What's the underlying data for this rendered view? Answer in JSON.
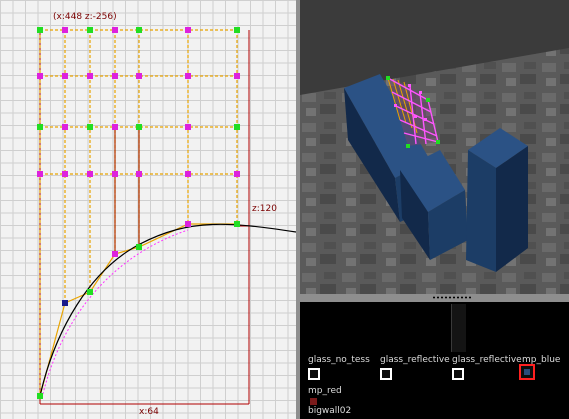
{
  "grid_view": {
    "top_coord_label": "(x:448  z:-256)",
    "right_coord_label": "z:120",
    "bottom_coord_label": "x:64",
    "colors": {
      "grid_line": "#cfcfcf",
      "control_line": "#e9a400",
      "frame_line": "#b00000",
      "curve": "#000000",
      "corner_handle": "#22dd22",
      "mid_handle": "#dd22dd",
      "selected_handle": "#1a1a8a"
    }
  },
  "camera_view": {
    "colors": {
      "floor": "#575757",
      "block_front": "#1c3d66",
      "block_side": "#12294a",
      "block_top": "#2b5285",
      "patch_mesh": "#ff55ff",
      "patch_edge": "#e9a400"
    }
  },
  "texture_browser": {
    "textures": [
      {
        "name": "glass_no_tess"
      },
      {
        "name": "glass_reflective"
      },
      {
        "name": "glass_reflective"
      },
      {
        "name": "mp_blue",
        "selected": true
      }
    ],
    "row2_label": "mp_red",
    "row3_label": "bigwall02"
  }
}
